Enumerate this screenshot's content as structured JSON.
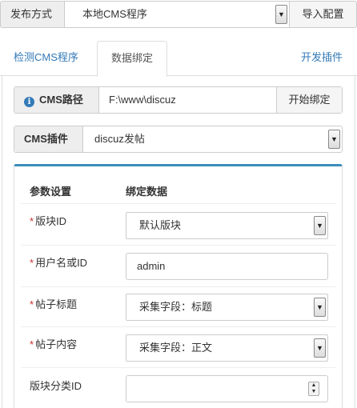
{
  "top": {
    "label": "发布方式",
    "selected": "本地CMS程序",
    "import_button": "导入配置"
  },
  "tabs": [
    {
      "label": "检测CMS程序"
    },
    {
      "label": "数据绑定"
    },
    {
      "label": "开发插件"
    }
  ],
  "cms_path": {
    "label": "CMS路径",
    "value": "F:\\www\\discuz",
    "button": "开始绑定"
  },
  "cms_plugin": {
    "label": "CMS插件",
    "selected": "discuz发帖"
  },
  "binding": {
    "header_param": "参数设置",
    "header_data": "绑定数据",
    "fields": [
      {
        "label": "版块ID",
        "required": true,
        "kind": "select",
        "value": "默认版块"
      },
      {
        "label": "用户名或ID",
        "required": true,
        "kind": "text",
        "value": "admin"
      },
      {
        "label": "帖子标题",
        "required": true,
        "kind": "select",
        "value": "采集字段：标题"
      },
      {
        "label": "帖子内容",
        "required": true,
        "kind": "select",
        "value": "采集字段：正文"
      },
      {
        "label": "版块分类ID",
        "required": false,
        "kind": "number",
        "value": ""
      }
    ]
  },
  "icons": {
    "dropdown": "chevron-down-icon",
    "info": "info-circle-icon",
    "spinner": "number-spinner-icon"
  },
  "colors": {
    "link": "#337ab7",
    "accent": "#3c8dbc",
    "required": "#c9302c"
  }
}
